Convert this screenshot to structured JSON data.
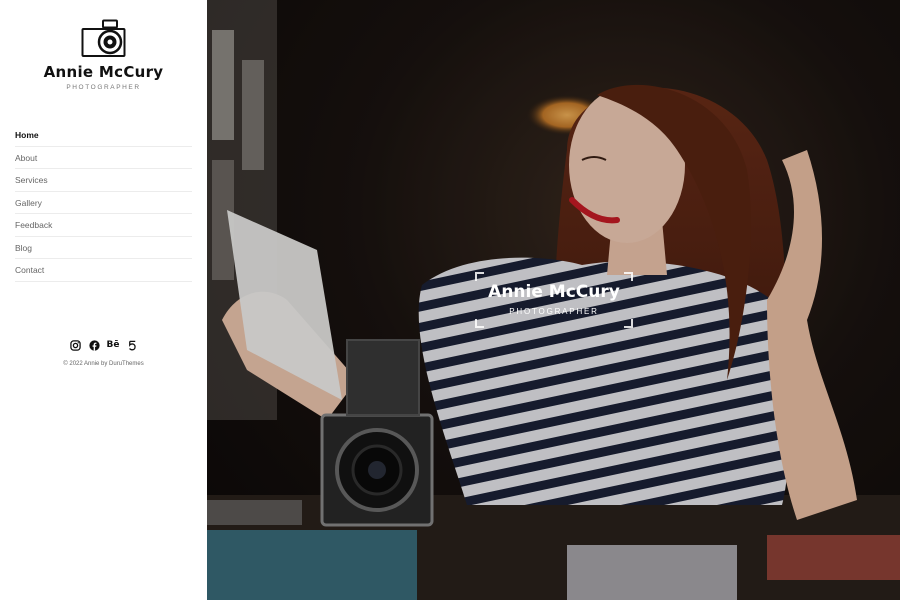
{
  "brand": {
    "name": "Annie McCury",
    "subtitle": "PHOTOGRAPHER",
    "logo_icon": "camera-icon"
  },
  "nav": {
    "items": [
      {
        "label": "Home",
        "active": true
      },
      {
        "label": "About",
        "active": false
      },
      {
        "label": "Services",
        "active": false
      },
      {
        "label": "Gallery",
        "active": false
      },
      {
        "label": "Feedback",
        "active": false
      },
      {
        "label": "Blog",
        "active": false
      },
      {
        "label": "Contact",
        "active": false
      }
    ]
  },
  "socials": [
    {
      "icon": "instagram-icon"
    },
    {
      "icon": "facebook-icon"
    },
    {
      "icon": "behance-icon",
      "text": "Bē"
    },
    {
      "icon": "fivehundredpx-icon"
    }
  ],
  "footer": {
    "copyright": "© 2022 Annie by DuruThemes"
  },
  "hero": {
    "title": "Annie McCury",
    "subtitle": "PHOTOGRAPHER",
    "image": "photo of a woman in a striped shirt holding a vintage camera"
  }
}
